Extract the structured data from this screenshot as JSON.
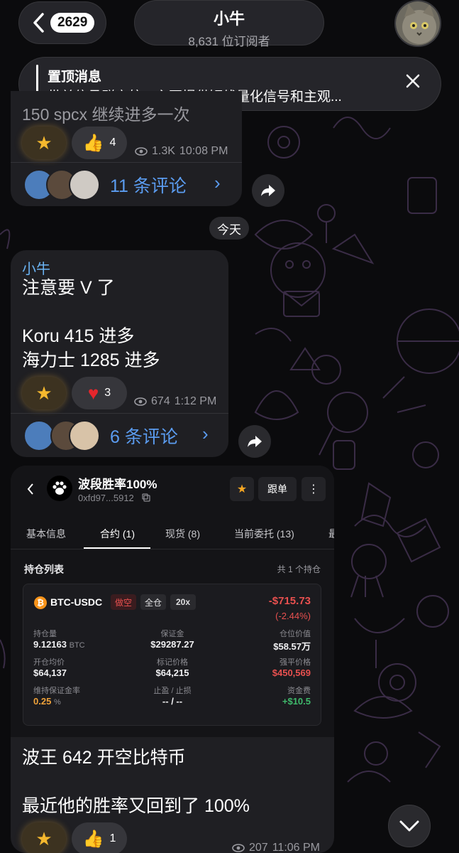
{
  "header": {
    "back_count": "2629",
    "title": "小牛",
    "subscribers": "8,631 位订阅者"
  },
  "pinned": {
    "label": "置顶消息",
    "text": "带单信号群启航：主要提供短线量化信号和主观..."
  },
  "message1": {
    "cut_text": "150   spcx   继续进多一次",
    "like_count": "4",
    "views": "1.3K",
    "time": "10:08 PM",
    "comments": "11 条评论"
  },
  "date_separator": "今天",
  "message2": {
    "sender": "小牛",
    "line1": "注意要 V 了",
    "line2": "Koru 415   进多",
    "line3": "海力士 1285 进多",
    "heart_count": "3",
    "views": "674",
    "time": "1:12 PM",
    "comments": "6  条评论"
  },
  "trade": {
    "name": "波段胜率100%",
    "address": "0xfd97...5912",
    "follow_label": "跟单",
    "tabs": [
      "基本信息",
      "合约 (1)",
      "现货 (8)",
      "当前委托 (13)",
      "最"
    ],
    "section_title": "持仓列表",
    "section_count": "共 1 个持仓",
    "position": {
      "symbol": "BTC-USDC",
      "side": "做空",
      "margin_mode": "全仓",
      "leverage": "20x",
      "pnl": "-$715.73",
      "pnl_pct": "(-2.44%)",
      "fields": [
        {
          "label": "持仓量",
          "value": "9.12163",
          "unit": "BTC"
        },
        {
          "label": "保证金",
          "value": "$29287.27"
        },
        {
          "label": "仓位价值",
          "value": "$58.57万"
        },
        {
          "label": "开仓均价",
          "value": "$64,137"
        },
        {
          "label": "标记价格",
          "value": "$64,215"
        },
        {
          "label": "强平价格",
          "value": "$450,569"
        },
        {
          "label": "维持保证金率",
          "value": "0.25",
          "unit": "%"
        },
        {
          "label": "止盈 / 止损",
          "value": "-- / --"
        },
        {
          "label": "资金费",
          "value": "+$10.5"
        }
      ]
    }
  },
  "message3": {
    "line1": "波王 642 开空比特币",
    "line2": "最近他的胜率又回到了 100%",
    "like_count": "1",
    "views": "207",
    "time": "11:06 PM"
  },
  "colors": {
    "accent_blue": "#5b9cf0",
    "sender_blue": "#6ab3f3",
    "loss_red": "#e8504f",
    "gain_green": "#3fb96b",
    "margin_orange": "#f0a23a",
    "bubble": "#1f1f23",
    "background": "#0b0b0d"
  }
}
